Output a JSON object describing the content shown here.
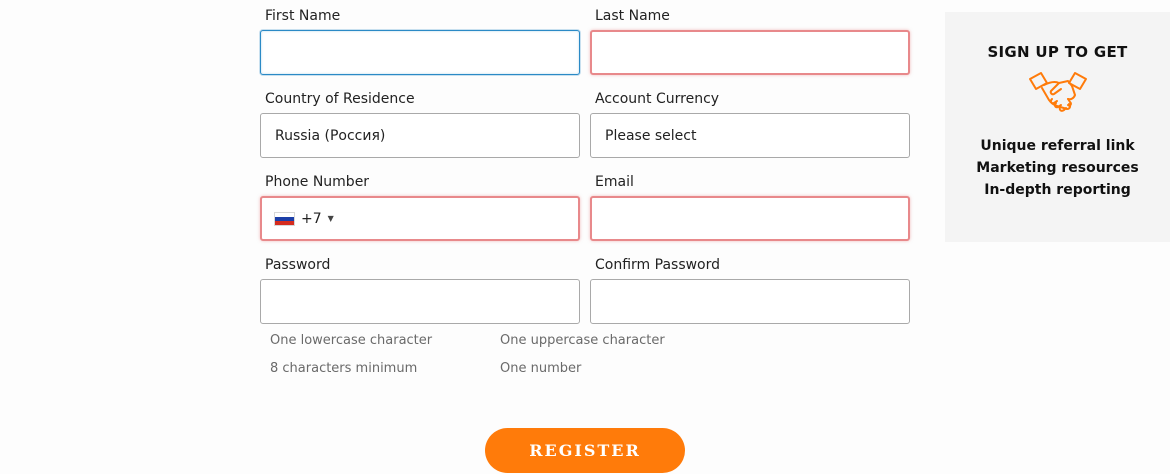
{
  "form": {
    "first_name_label": "First Name",
    "first_name_value": "",
    "last_name_label": "Last Name",
    "last_name_value": "",
    "country_label": "Country of Residence",
    "country_value": "Russia (Россия)",
    "currency_label": "Account Currency",
    "currency_value": "Please select",
    "phone_label": "Phone Number",
    "phone_dial_code": "+7",
    "phone_value": "",
    "email_label": "Email",
    "email_value": "",
    "password_label": "Password",
    "confirm_password_label": "Confirm Password"
  },
  "password_rules": [
    "One lowercase character",
    "One uppercase character",
    "8 characters minimum",
    "One number"
  ],
  "register_label": "REGISTER",
  "promo": {
    "title": "SIGN UP TO GET",
    "icon": "handshake-icon",
    "items": [
      "Unique referral link",
      "Marketing resources",
      "In-depth reporting"
    ]
  },
  "colors": {
    "accent": "#ff7b0a",
    "error_border": "#e8898b",
    "focus_border": "#2b8ac6",
    "promo_background": "#f4f4f4"
  }
}
